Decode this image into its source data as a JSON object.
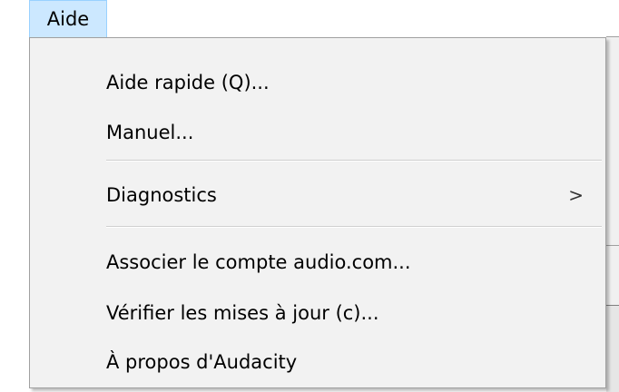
{
  "menubar": {
    "active_menu": "Aide"
  },
  "menu": {
    "items": [
      {
        "label": "Aide rapide (Q)..."
      },
      {
        "label": "Manuel..."
      },
      {
        "label": "Diagnostics",
        "submenu_indicator": ">"
      },
      {
        "label": "Associer le compte audio.com..."
      },
      {
        "label": "Vérifier les mises à jour (c)..."
      },
      {
        "label": "À propos d'Audacity"
      }
    ]
  },
  "colors": {
    "menubar_highlight": "#cce8ff",
    "menu_background": "#f2f2f2",
    "menu_border": "#a0a0a0"
  }
}
